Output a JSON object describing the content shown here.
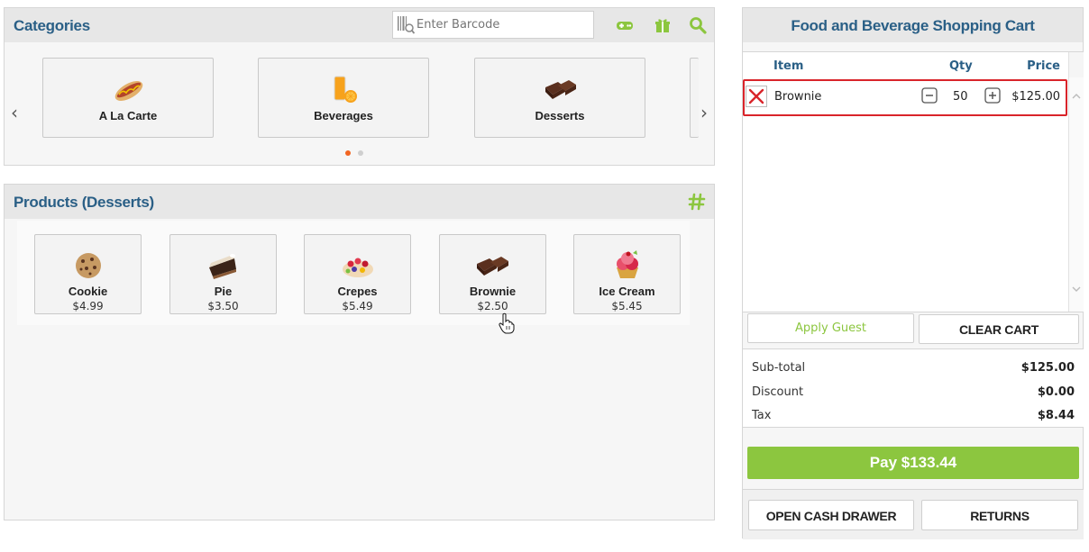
{
  "categories": {
    "title": "Categories",
    "barcode_placeholder": "Enter Barcode",
    "items": [
      {
        "label": "A La Carte",
        "icon": "hotdog-icon"
      },
      {
        "label": "Beverages",
        "icon": "orange-juice-icon"
      },
      {
        "label": "Desserts",
        "icon": "brownie-icon"
      }
    ],
    "header_icons": [
      "gamepad-icon",
      "gift-icon",
      "search-icon"
    ],
    "pager_dots": 2,
    "active_dot": 0
  },
  "products": {
    "title": "Products (Desserts)",
    "header_icon": "hashtag-icon",
    "items": [
      {
        "name": "Cookie",
        "price": "$4.99",
        "icon": "cookie-icon"
      },
      {
        "name": "Pie",
        "price": "$3.50",
        "icon": "pie-icon"
      },
      {
        "name": "Crepes",
        "price": "$5.49",
        "icon": "crepes-icon"
      },
      {
        "name": "Brownie",
        "price": "$2.50",
        "icon": "brownie-icon"
      },
      {
        "name": "Ice Cream",
        "price": "$5.45",
        "icon": "ice-cream-icon"
      }
    ]
  },
  "cart": {
    "title": "Food and Beverage Shopping Cart",
    "col_item": "Item",
    "col_qty": "Qty",
    "col_price": "Price",
    "rows": [
      {
        "name": "Brownie",
        "qty": "50",
        "price": "$125.00"
      }
    ],
    "apply_guest": "Apply Guest",
    "clear_cart": "CLEAR CART",
    "subtotal_label": "Sub-total",
    "subtotal": "$125.00",
    "discount_label": "Discount",
    "discount": "$0.00",
    "tax_label": "Tax",
    "tax": "$8.44",
    "pay_label": "Pay  $133.44",
    "open_drawer": "OPEN CASH DRAWER",
    "returns": "RETURNS"
  },
  "colors": {
    "accent_green": "#8cc63f",
    "title_blue": "#2a5f86",
    "highlight_red": "#d9242a",
    "active_dot": "#f26522"
  }
}
